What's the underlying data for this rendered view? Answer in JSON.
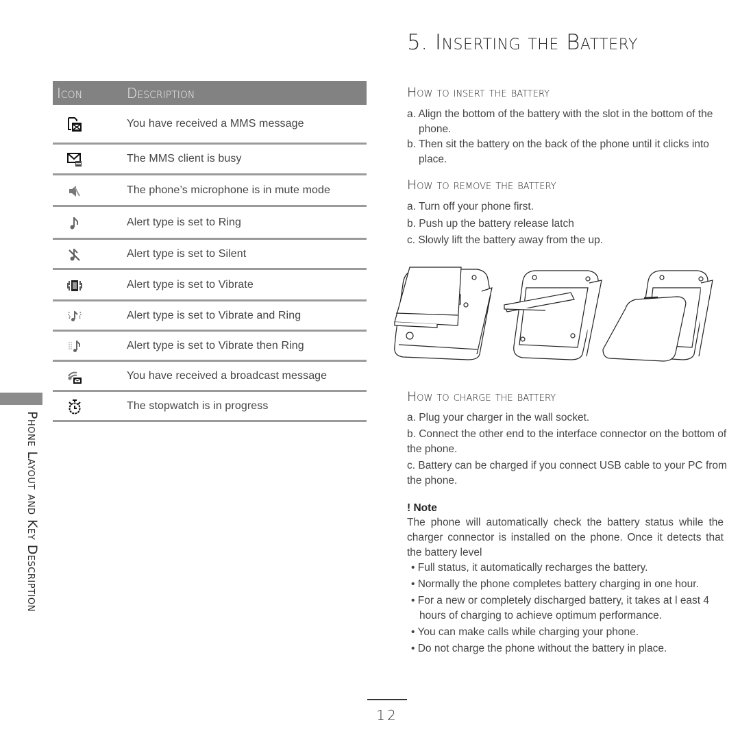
{
  "sidebar": {
    "section_label": "Phone Layout and Key Description"
  },
  "table": {
    "headers": {
      "icon": "Icon",
      "description": "Description"
    },
    "rows": [
      {
        "icon": "mms-received-icon",
        "description": "You have received a MMS message"
      },
      {
        "icon": "mms-busy-icon",
        "description": "The MMS client is busy"
      },
      {
        "icon": "microphone-mute-icon",
        "description": "The phone’s microphone is in mute mode"
      },
      {
        "icon": "ring-icon",
        "description": "Alert type is set to Ring"
      },
      {
        "icon": "silent-icon",
        "description": "Alert type is set to Silent"
      },
      {
        "icon": "vibrate-icon",
        "description": "Alert type is set to Vibrate"
      },
      {
        "icon": "vibrate-and-ring-icon",
        "description": "Alert type is set to Vibrate and Ring"
      },
      {
        "icon": "vibrate-then-ring-icon",
        "description": "Alert type is set to Vibrate then Ring"
      },
      {
        "icon": "broadcast-message-icon",
        "description": "You have received a broadcast message"
      },
      {
        "icon": "stopwatch-icon",
        "description": "The stopwatch is in progress"
      }
    ]
  },
  "main": {
    "title": "5. Inserting the Battery",
    "insert": {
      "heading": "How to insert the battery",
      "steps": [
        "a. Align the bottom of the battery with the slot in the bottom of the phone.",
        "b. Then sit the battery on the back of the phone until it clicks into place."
      ]
    },
    "remove": {
      "heading": "How to remove the battery",
      "steps": [
        "a. Turn off your phone first.",
        "b. Push up the battery release latch",
        "c. Slowly lift the battery away from the up."
      ]
    },
    "illustrations": [
      "battery-removed-illustration",
      "battery-inserting-illustration",
      "battery-cover-illustration"
    ],
    "charge": {
      "heading": "How to charge the battery",
      "steps": [
        "a. Plug your charger in the wall socket.",
        "b. Connect the other end to the interface connector on the bottom of the phone.",
        "c. Battery can be charged if you connect USB cable to your PC from the phone."
      ]
    },
    "note": {
      "title": "! Note",
      "body": "The phone will automatically check the battery status while the charger connector is installed on the phone. Once it detects that the battery level",
      "bullets": [
        "Full status, it automatically recharges the battery.",
        "Normally the phone completes battery charging in one hour.",
        "For a new or completely discharged battery, it takes at l east 4 hours of charging to achieve optimum performance.",
        "You can make calls while charging your phone.",
        "Do not charge the phone without the battery in place."
      ]
    }
  },
  "footer": {
    "page_number": "12"
  }
}
